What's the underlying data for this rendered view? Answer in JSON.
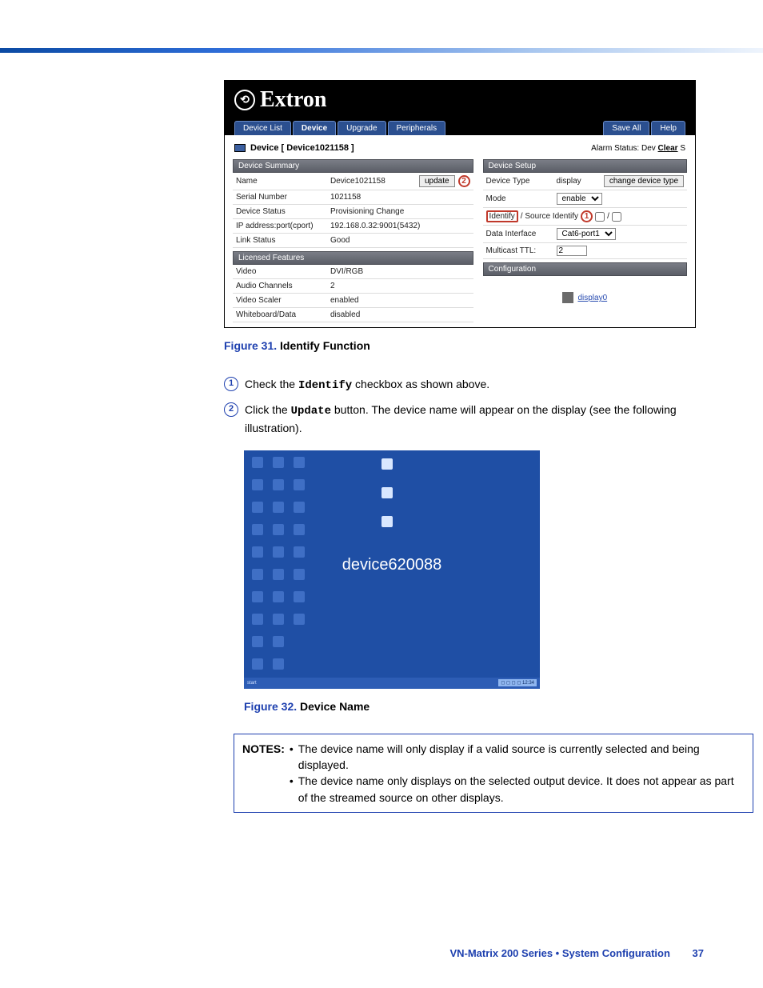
{
  "extron": {
    "brand": "Extron",
    "tabs": [
      "Device List",
      "Device",
      "Upgrade",
      "Peripherals"
    ],
    "right_tabs": [
      "Save All",
      "Help"
    ],
    "device_header_label": "Device [ Device1021158 ]",
    "alarm_prefix": "Alarm Status: Dev ",
    "alarm_clear": "Clear",
    "alarm_suffix": " S",
    "summary": {
      "title": "Device Summary",
      "rows": [
        {
          "k": "Name",
          "v": "Device1021158",
          "btn": "update"
        },
        {
          "k": "Serial Number",
          "v": "1021158"
        },
        {
          "k": "Device Status",
          "v": "Provisioning Change"
        },
        {
          "k": "IP address:port(cport)",
          "v": "192.168.0.32:9001(5432)"
        },
        {
          "k": "Link Status",
          "v": "Good"
        }
      ]
    },
    "setup": {
      "title": "Device Setup",
      "device_type_k": "Device Type",
      "device_type_v": "display",
      "change_btn": "change device type",
      "mode_k": "Mode",
      "mode_v": "enable",
      "identify_label": "Identify",
      "source_identify_label": " / Source Identify",
      "slash": " / ",
      "data_iface_k": "Data Interface",
      "data_iface_v": "Cat6-port1",
      "mcast_k": "Multicast TTL:",
      "mcast_v": "2"
    },
    "licensed": {
      "title": "Licensed Features",
      "rows": [
        {
          "k": "Video",
          "v": "DVI/RGB"
        },
        {
          "k": "Audio Channels",
          "v": "2"
        },
        {
          "k": "Video Scaler",
          "v": "enabled"
        },
        {
          "k": "Whiteboard/Data",
          "v": "disabled"
        }
      ]
    },
    "config": {
      "title": "Configuration",
      "link": "display0"
    }
  },
  "fig31": {
    "num": "Figure 31.",
    "title": " Identify Function"
  },
  "steps": {
    "s1_a": "Check the ",
    "s1_b": "Identify",
    "s1_c": " checkbox as shown above.",
    "s2_a": "Click the ",
    "s2_b": "Update",
    "s2_c": " button. The device name will appear on the display (see the following illustration)."
  },
  "desktop": {
    "big_label": "device620088"
  },
  "fig32": {
    "num": "Figure 32.",
    "title": " Device Name"
  },
  "notes": {
    "label": "NOTES:",
    "n1": "The device name will only display if a valid source is currently selected and being displayed.",
    "n2": "The device name only displays on the selected output device. It does not appear as part of the streamed source on other displays."
  },
  "footer": {
    "text": "VN-Matrix 200 Series  •  System Configuration",
    "page": "37"
  }
}
